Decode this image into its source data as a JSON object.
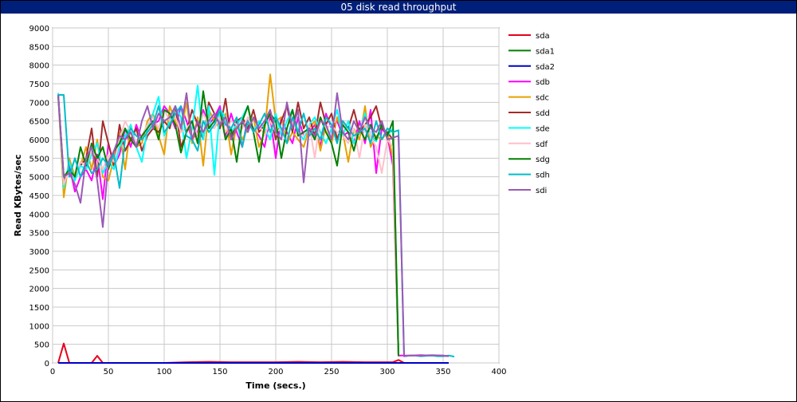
{
  "window": {
    "title": "05 disk read throughput"
  },
  "chart_data": {
    "type": "line",
    "title": "05 disk read throughput",
    "xlabel": "Time (secs.)",
    "ylabel": "Read KBytes/sec",
    "xlim": [
      0,
      400
    ],
    "ylim": [
      0,
      9000
    ],
    "xticks": [
      0,
      50,
      100,
      150,
      200,
      250,
      300,
      350,
      400
    ],
    "yticks": [
      0,
      500,
      1000,
      1500,
      2000,
      2500,
      3000,
      3500,
      4000,
      4500,
      5000,
      5500,
      6000,
      6500,
      7000,
      7500,
      8000,
      8500,
      9000
    ],
    "grid": true,
    "legend_position": "right",
    "series": [
      {
        "name": "sda",
        "color": "#e8001c",
        "x": [
          5,
          10,
          15,
          20,
          25,
          30,
          35,
          40,
          45,
          50,
          60,
          80,
          100,
          120,
          140,
          160,
          180,
          200,
          220,
          240,
          260,
          280,
          300,
          305,
          310,
          315,
          320,
          330,
          340,
          350,
          355
        ],
        "y": [
          0,
          520,
          0,
          0,
          0,
          0,
          0,
          190,
          0,
          0,
          0,
          0,
          0,
          20,
          30,
          20,
          20,
          20,
          30,
          20,
          30,
          20,
          20,
          20,
          80,
          0,
          0,
          0,
          0,
          0,
          0
        ]
      },
      {
        "name": "sda1",
        "color": "#008000",
        "x": [
          5,
          10,
          15,
          20,
          25,
          30,
          35,
          40,
          45,
          50,
          60,
          80,
          100,
          150,
          200,
          250,
          300,
          310,
          315,
          320,
          330,
          340,
          350,
          355
        ],
        "y": [
          0,
          0,
          0,
          0,
          0,
          0,
          0,
          0,
          0,
          0,
          0,
          0,
          0,
          0,
          0,
          0,
          0,
          0,
          0,
          0,
          0,
          0,
          0,
          0
        ]
      },
      {
        "name": "sda2",
        "color": "#0000c8",
        "x": [
          5,
          50,
          100,
          150,
          200,
          250,
          300,
          310,
          315,
          355
        ],
        "y": [
          0,
          0,
          0,
          0,
          0,
          0,
          0,
          0,
          0,
          0
        ]
      },
      {
        "name": "sdb",
        "color": "#ff00ff",
        "x": [
          5,
          10,
          15,
          20,
          25,
          30,
          35,
          40,
          45,
          50,
          55,
          60,
          65,
          70,
          75,
          80,
          85,
          90,
          95,
          100,
          105,
          110,
          115,
          120,
          125,
          130,
          135,
          140,
          145,
          150,
          155,
          160,
          165,
          170,
          175,
          180,
          185,
          190,
          195,
          200,
          205,
          210,
          215,
          220,
          225,
          230,
          235,
          240,
          245,
          250,
          255,
          260,
          265,
          270,
          275,
          280,
          285,
          290,
          295,
          300,
          305,
          310,
          315,
          320,
          330,
          340,
          350,
          355
        ],
        "y": [
          7250,
          4700,
          5300,
          4600,
          5000,
          5200,
          4900,
          5600,
          4400,
          5900,
          5300,
          5600,
          6300,
          5800,
          6400,
          6000,
          6200,
          6400,
          6500,
          6900,
          6700,
          6300,
          6900,
          6500,
          6000,
          6200,
          6800,
          6400,
          6600,
          6900,
          6100,
          6700,
          6200,
          5800,
          6600,
          6300,
          6100,
          5800,
          6600,
          5500,
          6600,
          6200,
          5900,
          6600,
          6100,
          6200,
          6400,
          5800,
          6700,
          6300,
          6500,
          6100,
          6200,
          5900,
          6500,
          5900,
          6800,
          5100,
          6300,
          6100,
          5300,
          200,
          200,
          200,
          210,
          200,
          200,
          180
        ]
      },
      {
        "name": "sdc",
        "color": "#e8a000",
        "x": [
          5,
          10,
          15,
          20,
          25,
          30,
          35,
          40,
          45,
          50,
          55,
          60,
          65,
          70,
          75,
          80,
          85,
          90,
          95,
          100,
          105,
          110,
          115,
          120,
          125,
          130,
          135,
          140,
          145,
          150,
          155,
          160,
          165,
          170,
          175,
          180,
          185,
          190,
          195,
          200,
          205,
          210,
          215,
          220,
          225,
          230,
          235,
          240,
          245,
          250,
          255,
          260,
          265,
          270,
          275,
          280,
          285,
          290,
          295,
          300,
          305,
          310
        ],
        "y": [
          7200,
          4450,
          5500,
          5000,
          5300,
          5800,
          5200,
          6000,
          5000,
          4900,
          5500,
          6200,
          5200,
          6400,
          5800,
          5900,
          6500,
          6700,
          6100,
          5600,
          6900,
          6500,
          6200,
          7000,
          5900,
          6600,
          5300,
          6800,
          6500,
          6300,
          6700,
          5600,
          6400,
          6000,
          6300,
          6600,
          5800,
          6200,
          7750,
          6500,
          6600,
          5900,
          6200,
          6000,
          5800,
          6300,
          6500,
          5700,
          6400,
          5900,
          6600,
          6200,
          5400,
          6300,
          6000,
          6900,
          5800,
          6100,
          6000,
          6200,
          5500,
          200
        ]
      },
      {
        "name": "sdd",
        "color": "#a52a2a",
        "x": [
          5,
          10,
          15,
          20,
          25,
          30,
          35,
          40,
          45,
          50,
          55,
          60,
          65,
          70,
          75,
          80,
          85,
          90,
          95,
          100,
          105,
          110,
          115,
          120,
          125,
          130,
          135,
          140,
          145,
          150,
          155,
          160,
          165,
          170,
          175,
          180,
          185,
          190,
          195,
          200,
          205,
          210,
          215,
          220,
          225,
          230,
          235,
          240,
          245,
          250,
          255,
          260,
          265,
          270,
          275,
          280,
          285,
          290,
          295,
          300,
          305,
          310
        ],
        "y": [
          7200,
          4900,
          5200,
          5000,
          5300,
          5500,
          6300,
          5000,
          6500,
          5900,
          5300,
          6400,
          5700,
          6000,
          6300,
          5700,
          6100,
          6300,
          6200,
          6500,
          6300,
          6900,
          5800,
          6200,
          6800,
          6400,
          6000,
          7000,
          6700,
          6300,
          7100,
          6000,
          6500,
          6600,
          6300,
          6800,
          6200,
          6400,
          6700,
          6000,
          6500,
          6900,
          6200,
          7000,
          6300,
          6600,
          6100,
          7000,
          6400,
          6700,
          6000,
          6500,
          6300,
          6800,
          6200,
          6400,
          6600,
          6900,
          6300,
          6200,
          6000,
          200
        ]
      },
      {
        "name": "sde",
        "color": "#00ffff",
        "x": [
          5,
          10,
          15,
          20,
          25,
          30,
          35,
          40,
          45,
          50,
          55,
          60,
          65,
          70,
          75,
          80,
          85,
          90,
          95,
          100,
          105,
          110,
          115,
          120,
          125,
          130,
          135,
          140,
          145,
          150,
          155,
          160,
          165,
          170,
          175,
          180,
          185,
          190,
          195,
          200,
          205,
          210,
          215,
          220,
          225,
          230,
          235,
          240,
          245,
          250,
          255,
          260,
          265,
          270,
          275,
          280,
          285,
          290,
          295,
          300,
          305,
          310
        ],
        "y": [
          7250,
          4700,
          5400,
          4900,
          5300,
          5200,
          5600,
          5900,
          5100,
          5400,
          5200,
          5800,
          6100,
          6400,
          5800,
          5400,
          6300,
          6700,
          7150,
          6100,
          6500,
          6900,
          6600,
          5500,
          6300,
          7450,
          6000,
          6900,
          5050,
          6800,
          6600,
          6200,
          6400,
          6600,
          6900,
          6200,
          6500,
          6300,
          6000,
          6700,
          6100,
          6500,
          6800,
          6200,
          6000,
          6400,
          6600,
          6200,
          5900,
          6300,
          6800,
          6100,
          6500,
          5900,
          6200,
          6700,
          6100,
          5950,
          6400,
          6100,
          6300,
          180
        ]
      },
      {
        "name": "sdf",
        "color": "#ffc0cb",
        "x": [
          5,
          10,
          15,
          20,
          25,
          30,
          35,
          40,
          45,
          50,
          55,
          60,
          65,
          70,
          75,
          80,
          85,
          90,
          95,
          100,
          105,
          110,
          115,
          120,
          125,
          130,
          135,
          140,
          145,
          150,
          155,
          160,
          165,
          170,
          175,
          180,
          185,
          190,
          195,
          200,
          205,
          210,
          215,
          220,
          225,
          230,
          235,
          240,
          245,
          250,
          255,
          260,
          265,
          270,
          275,
          280,
          285,
          290,
          295,
          300,
          305,
          310
        ],
        "y": [
          7200,
          4800,
          5200,
          5000,
          5400,
          5300,
          5700,
          5500,
          5200,
          5600,
          5400,
          6000,
          6500,
          6200,
          5900,
          6100,
          6400,
          6600,
          6300,
          6800,
          6500,
          6600,
          6200,
          6300,
          6500,
          6100,
          6700,
          6400,
          6300,
          6600,
          6200,
          6500,
          6400,
          6300,
          6600,
          6200,
          6400,
          6100,
          6500,
          6200,
          6300,
          6000,
          6500,
          6200,
          6100,
          6400,
          5500,
          6600,
          6300,
          6400,
          6200,
          6100,
          5900,
          6300,
          5500,
          6400,
          6100,
          5800,
          5100,
          6000,
          5800,
          200
        ]
      },
      {
        "name": "sdg",
        "color": "#008000",
        "x": [
          5,
          10,
          15,
          20,
          25,
          30,
          35,
          40,
          45,
          50,
          55,
          60,
          65,
          70,
          75,
          80,
          85,
          90,
          95,
          100,
          105,
          110,
          115,
          120,
          125,
          130,
          135,
          140,
          145,
          150,
          155,
          160,
          165,
          170,
          175,
          180,
          185,
          190,
          195,
          200,
          205,
          210,
          215,
          220,
          225,
          230,
          235,
          240,
          245,
          250,
          255,
          260,
          265,
          270,
          275,
          280,
          285,
          290,
          295,
          300,
          305,
          310
        ],
        "y": [
          7200,
          5000,
          5200,
          5000,
          5800,
          5300,
          5900,
          5500,
          5800,
          5200,
          5700,
          5900,
          6300,
          6000,
          5800,
          6100,
          6300,
          6500,
          6000,
          6800,
          6700,
          6400,
          5650,
          6200,
          6500,
          5900,
          7300,
          6300,
          6500,
          6800,
          6000,
          6300,
          5400,
          6500,
          6900,
          6200,
          5400,
          6400,
          6700,
          6500,
          5500,
          6300,
          6800,
          6100,
          6200,
          6300,
          6000,
          6600,
          6200,
          5900,
          5300,
          6400,
          6200,
          5700,
          6300,
          6000,
          6400,
          6000,
          6400,
          6100,
          6500,
          180
        ]
      },
      {
        "name": "sdh",
        "color": "#00bcc8",
        "x": [
          5,
          10,
          15,
          20,
          25,
          30,
          35,
          40,
          45,
          50,
          55,
          60,
          65,
          70,
          75,
          80,
          85,
          90,
          95,
          100,
          105,
          110,
          115,
          120,
          125,
          130,
          135,
          140,
          145,
          150,
          155,
          160,
          165,
          170,
          175,
          180,
          185,
          190,
          195,
          200,
          205,
          210,
          215,
          220,
          225,
          230,
          235,
          240,
          245,
          250,
          255,
          260,
          265,
          270,
          275,
          280,
          285,
          290,
          295,
          300,
          305,
          310,
          315,
          320,
          325,
          330,
          335,
          340,
          345,
          350,
          355,
          360
        ],
        "y": [
          7200,
          7200,
          5000,
          5500,
          5000,
          5400,
          5100,
          5200,
          5500,
          5300,
          5600,
          4700,
          6000,
          6300,
          6100,
          6000,
          6200,
          6400,
          6900,
          6200,
          6400,
          6700,
          6900,
          6100,
          6000,
          5700,
          6500,
          6200,
          6400,
          6800,
          6400,
          6300,
          6600,
          5800,
          6500,
          6200,
          6400,
          6700,
          6200,
          6600,
          6300,
          5900,
          6600,
          6200,
          6700,
          6100,
          6300,
          6000,
          6600,
          6400,
          5900,
          6500,
          6300,
          6100,
          6200,
          6300,
          5900,
          6500,
          6000,
          6300,
          6200,
          6250,
          180,
          200,
          200,
          180,
          190,
          200,
          180,
          180,
          200,
          170
        ]
      },
      {
        "name": "sdi",
        "color": "#9b59b6",
        "x": [
          5,
          10,
          15,
          20,
          25,
          30,
          35,
          40,
          45,
          50,
          55,
          60,
          65,
          70,
          75,
          80,
          85,
          90,
          95,
          100,
          105,
          110,
          115,
          120,
          125,
          130,
          135,
          140,
          145,
          150,
          155,
          160,
          165,
          170,
          175,
          180,
          185,
          190,
          195,
          200,
          205,
          210,
          215,
          220,
          225,
          230,
          235,
          240,
          245,
          250,
          255,
          260,
          265,
          270,
          275,
          280,
          285,
          290,
          295,
          300,
          305,
          310,
          315,
          320,
          330,
          340,
          350,
          355
        ],
        "y": [
          7200,
          5000,
          5100,
          4800,
          4300,
          5500,
          5800,
          4900,
          3650,
          5400,
          5700,
          6100,
          6000,
          6200,
          5800,
          6500,
          6900,
          6300,
          6700,
          6500,
          6600,
          6900,
          6300,
          7250,
          6000,
          6500,
          6200,
          6500,
          6700,
          6400,
          6600,
          6000,
          6300,
          6500,
          6200,
          6600,
          6300,
          6500,
          6800,
          6200,
          6000,
          7000,
          6300,
          6800,
          4850,
          6300,
          6100,
          6500,
          6400,
          6000,
          7250,
          6200,
          6000,
          6500,
          6200,
          6600,
          6300,
          6200,
          6500,
          6000,
          6050,
          6100,
          180,
          200,
          200,
          210,
          200,
          180
        ]
      }
    ]
  }
}
